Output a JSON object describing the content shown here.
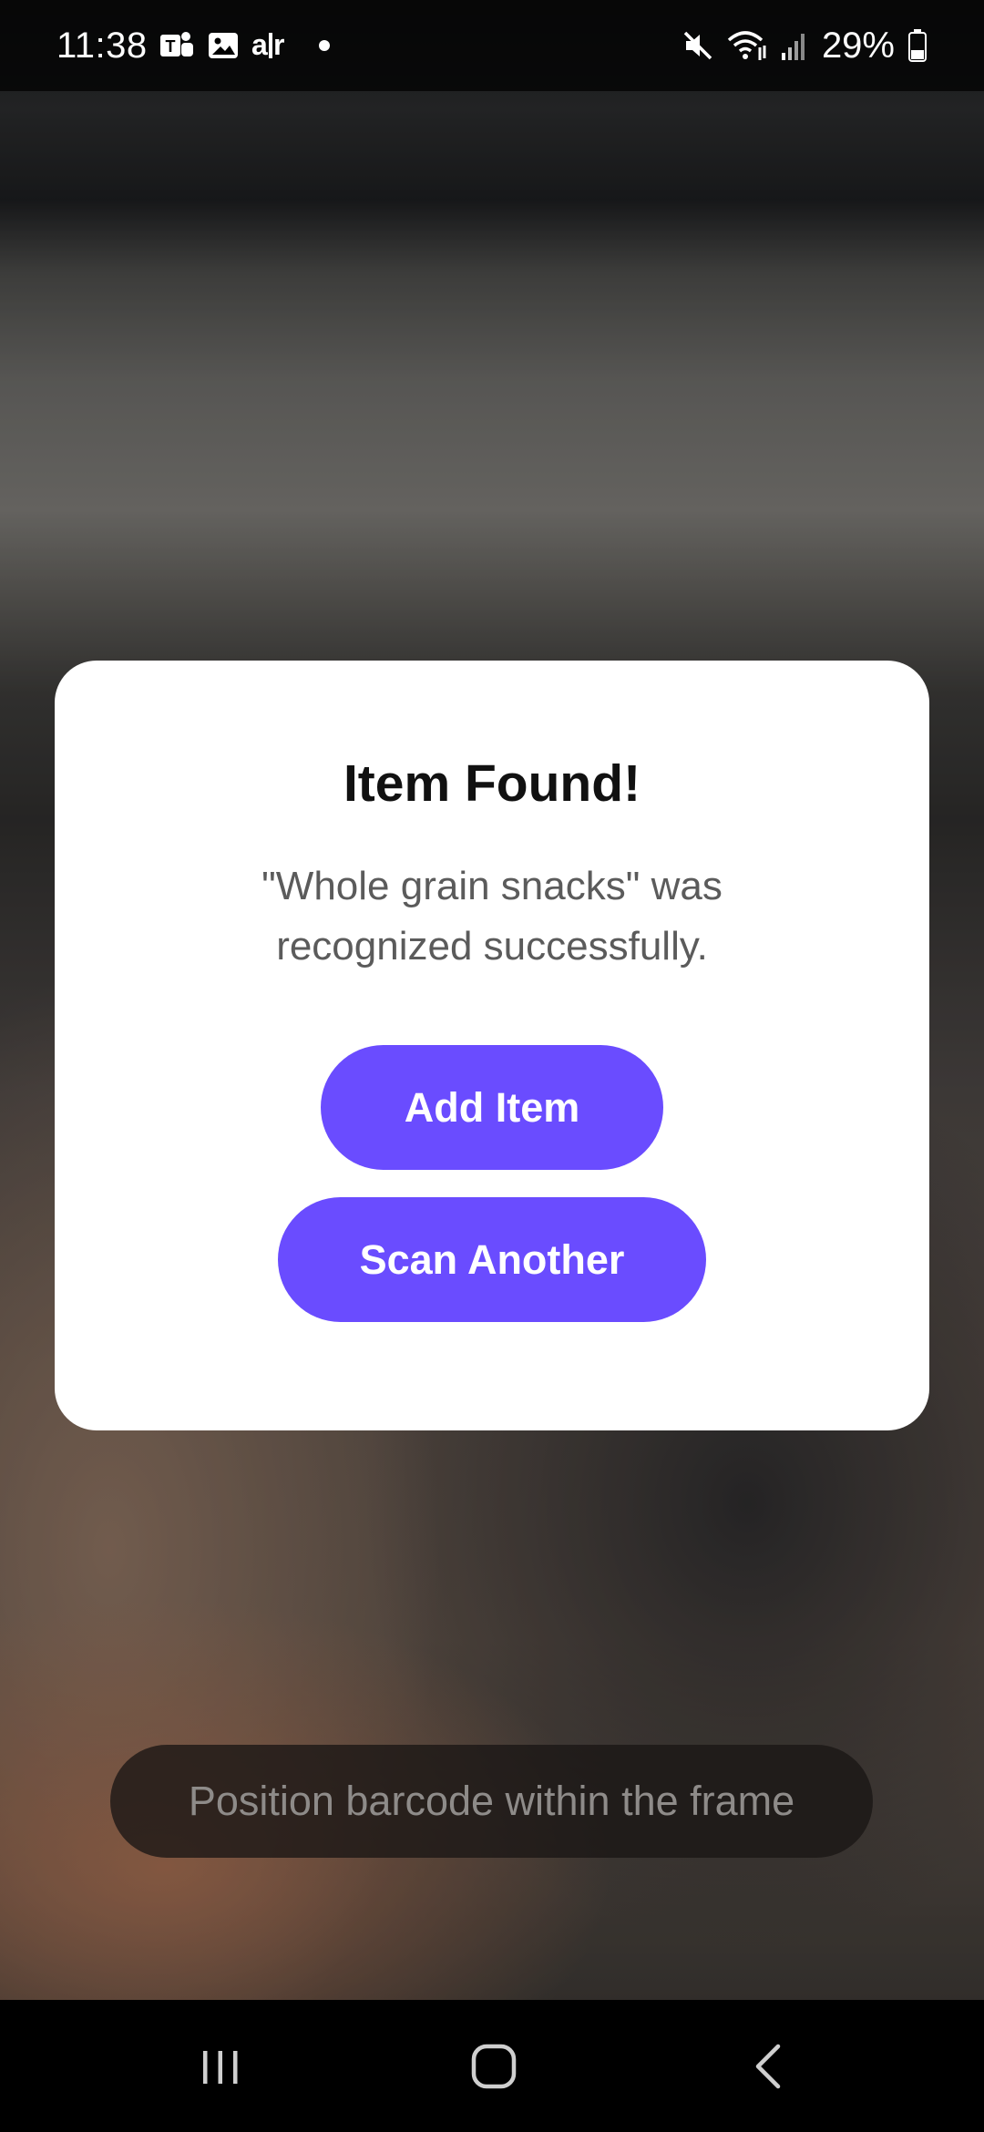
{
  "status_bar": {
    "time": "11:38",
    "battery": "29%",
    "icons_left": [
      "teams-icon",
      "gallery-icon",
      "air-icon",
      "notification-dot"
    ],
    "icons_right": [
      "mute-icon",
      "wifi-icon",
      "signal-icon",
      "battery-icon"
    ]
  },
  "dialog": {
    "title": "Item Found!",
    "message": "\"Whole grain snacks\" was recognized successfully.",
    "add_button": "Add Item",
    "scan_button": "Scan Another"
  },
  "hint": {
    "text": "Position barcode within the frame"
  },
  "nav": {
    "buttons": [
      "recents",
      "home",
      "back"
    ]
  },
  "colors": {
    "accent": "#6a4cff",
    "dialog_bg": "#ffffff",
    "title_text": "#111111",
    "message_text": "#5b5b5b"
  }
}
